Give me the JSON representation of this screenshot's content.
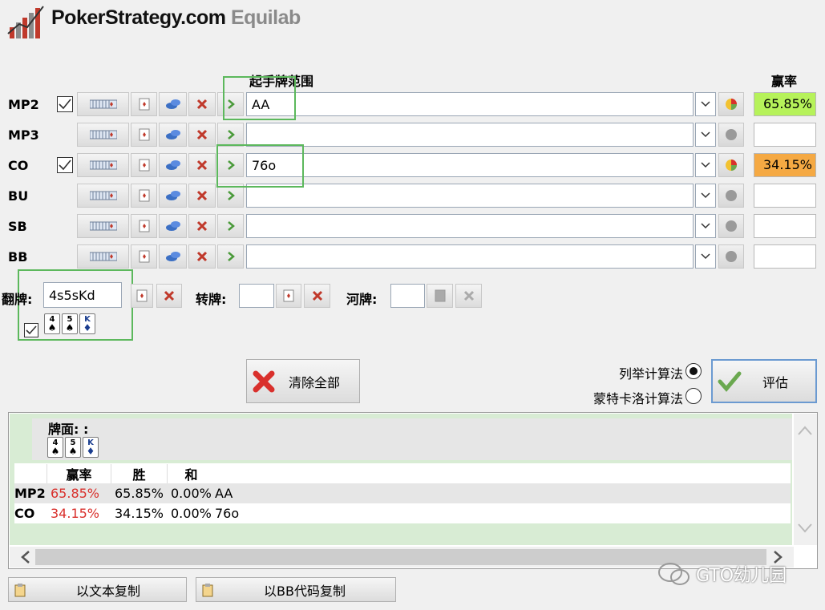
{
  "app": {
    "brand_main": "PokerStrategy.com",
    "brand_sub": "Equilab"
  },
  "headers": {
    "range": "起手牌范围",
    "equity": "赢率"
  },
  "players": [
    {
      "pos": "MP2",
      "checked": true,
      "range": "AA",
      "equity": "65.85%",
      "equity_color": "#b6f25a",
      "active": true
    },
    {
      "pos": "MP3",
      "checked": false,
      "range": "",
      "equity": "",
      "equity_color": "#ffffff",
      "active": false
    },
    {
      "pos": "CO",
      "checked": true,
      "range": "76o",
      "equity": "34.15%",
      "equity_color": "#f5a943",
      "active": true
    },
    {
      "pos": "BU",
      "checked": false,
      "range": "",
      "equity": "",
      "equity_color": "#ffffff",
      "active": false
    },
    {
      "pos": "SB",
      "checked": false,
      "range": "",
      "equity": "",
      "equity_color": "#ffffff",
      "active": false
    },
    {
      "pos": "BB",
      "checked": false,
      "range": "",
      "equity": "",
      "equity_color": "#ffffff",
      "active": false
    }
  ],
  "board": {
    "flop_label": "翻牌:",
    "flop_value": "4s5sKd",
    "turn_label": "转牌:",
    "turn_value": "",
    "river_label": "河牌:",
    "river_value": "",
    "cards": [
      {
        "rank": "4",
        "suit": "♠",
        "color": "#000000"
      },
      {
        "rank": "5",
        "suit": "♠",
        "color": "#000000"
      },
      {
        "rank": "K",
        "suit": "♦",
        "color": "#1a3d8f"
      }
    ]
  },
  "actions": {
    "clear_all": "清除全部",
    "enumerate": "列举计算法",
    "monte_carlo": "蒙特卡洛计算法",
    "evaluate": "评估"
  },
  "results": {
    "board_title": "牌面: :",
    "columns": [
      "",
      "赢率",
      "胜",
      "和",
      ""
    ],
    "rows": [
      {
        "pos": "MP2",
        "equity": "65.85%",
        "win": "65.85%",
        "tie": "0.00%",
        "hand": "AA"
      },
      {
        "pos": "CO",
        "equity": "34.15%",
        "win": "34.15%",
        "tie": "0.00%",
        "hand": "76o"
      }
    ]
  },
  "footer": {
    "copy_text": "以文本复制",
    "copy_bb": "以BB代码复制",
    "watermark": "GTO幼儿园"
  },
  "colors": {
    "accent_green": "#5cb85c",
    "equity_red": "#d9302c",
    "result_bg": "#d8ecd4"
  }
}
